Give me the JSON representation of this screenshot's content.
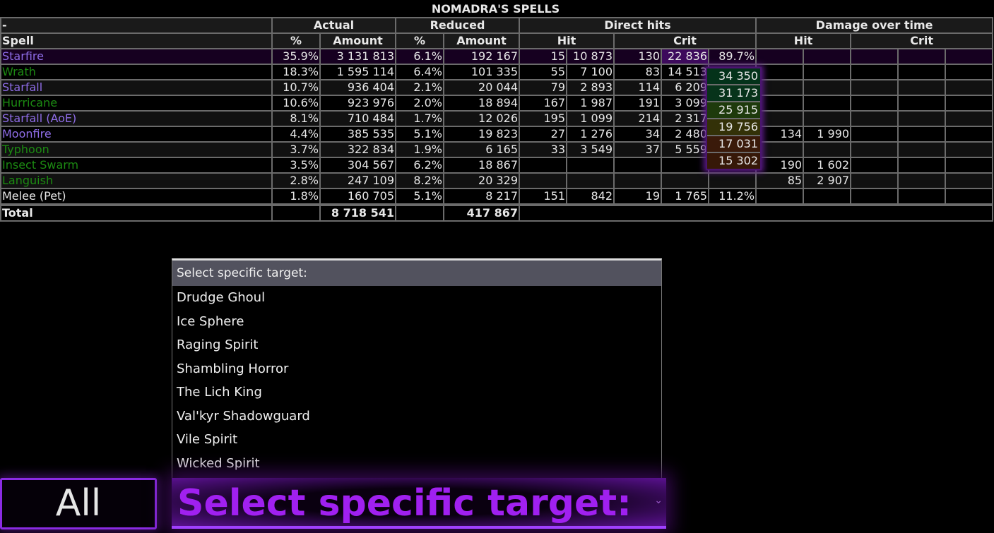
{
  "title": "NOMADRA'S SPELLS",
  "header": {
    "corner": "-",
    "spell": "Spell",
    "groups": [
      "Actual",
      "Reduced",
      "Direct hits",
      "Damage over time"
    ],
    "actual_cols": [
      "%",
      "Amount"
    ],
    "reduced_cols": [
      "%",
      "Amount"
    ],
    "direct_sub": [
      "Hit",
      "Crit"
    ],
    "dot_sub": [
      "Hit",
      "Crit"
    ]
  },
  "rows": [
    {
      "name": "Starfire",
      "color": "purple",
      "actual_pct": "35.9%",
      "actual_amt": "3 131 813",
      "red_pct": "6.1%",
      "red_amt": "192 167",
      "dh_hit_n": "15",
      "dh_hit_avg": "10 873",
      "dh_crit_n": "130",
      "dh_crit_avg": "22 836",
      "dh_crit_pct": "89.7%",
      "dot_hit_n": "",
      "dot_hit_avg": "",
      "dot_c1": "",
      "dot_c2": "",
      "dot_c3": ""
    },
    {
      "name": "Wrath",
      "color": "green",
      "actual_pct": "18.3%",
      "actual_amt": "1 595 114",
      "red_pct": "6.4%",
      "red_amt": "101 335",
      "dh_hit_n": "55",
      "dh_hit_avg": "7 100",
      "dh_crit_n": "83",
      "dh_crit_avg": "14 513",
      "dh_crit_pct": "",
      "dot_hit_n": "",
      "dot_hit_avg": "",
      "dot_c1": "",
      "dot_c2": "",
      "dot_c3": ""
    },
    {
      "name": "Starfall",
      "color": "purple",
      "actual_pct": "10.7%",
      "actual_amt": "936 404",
      "red_pct": "2.1%",
      "red_amt": "20 044",
      "dh_hit_n": "79",
      "dh_hit_avg": "2 893",
      "dh_crit_n": "114",
      "dh_crit_avg": "6 209",
      "dh_crit_pct": "",
      "dot_hit_n": "",
      "dot_hit_avg": "",
      "dot_c1": "",
      "dot_c2": "",
      "dot_c3": ""
    },
    {
      "name": "Hurricane",
      "color": "green",
      "actual_pct": "10.6%",
      "actual_amt": "923 976",
      "red_pct": "2.0%",
      "red_amt": "18 894",
      "dh_hit_n": "167",
      "dh_hit_avg": "1 987",
      "dh_crit_n": "191",
      "dh_crit_avg": "3 099",
      "dh_crit_pct": "",
      "dot_hit_n": "",
      "dot_hit_avg": "",
      "dot_c1": "",
      "dot_c2": "",
      "dot_c3": ""
    },
    {
      "name": "Starfall (AoE)",
      "color": "purple",
      "actual_pct": "8.1%",
      "actual_amt": "710 484",
      "red_pct": "1.7%",
      "red_amt": "12 026",
      "dh_hit_n": "195",
      "dh_hit_avg": "1 099",
      "dh_crit_n": "214",
      "dh_crit_avg": "2 317",
      "dh_crit_pct": "",
      "dot_hit_n": "",
      "dot_hit_avg": "",
      "dot_c1": "",
      "dot_c2": "",
      "dot_c3": ""
    },
    {
      "name": "Moonfire",
      "color": "purple",
      "actual_pct": "4.4%",
      "actual_amt": "385 535",
      "red_pct": "5.1%",
      "red_amt": "19 823",
      "dh_hit_n": "27",
      "dh_hit_avg": "1 276",
      "dh_crit_n": "34",
      "dh_crit_avg": "2 480",
      "dh_crit_pct": "",
      "dot_hit_n": "134",
      "dot_hit_avg": "1 990",
      "dot_c1": "",
      "dot_c2": "",
      "dot_c3": ""
    },
    {
      "name": "Typhoon",
      "color": "green",
      "actual_pct": "3.7%",
      "actual_amt": "322 834",
      "red_pct": "1.9%",
      "red_amt": "6 165",
      "dh_hit_n": "33",
      "dh_hit_avg": "3 549",
      "dh_crit_n": "37",
      "dh_crit_avg": "5 559",
      "dh_crit_pct": "",
      "dot_hit_n": "",
      "dot_hit_avg": "",
      "dot_c1": "",
      "dot_c2": "",
      "dot_c3": ""
    },
    {
      "name": "Insect Swarm",
      "color": "green",
      "actual_pct": "3.5%",
      "actual_amt": "304 567",
      "red_pct": "6.2%",
      "red_amt": "18 867",
      "dh_hit_n": "",
      "dh_hit_avg": "",
      "dh_crit_n": "",
      "dh_crit_avg": "",
      "dh_crit_pct": "",
      "dot_hit_n": "190",
      "dot_hit_avg": "1 602",
      "dot_c1": "",
      "dot_c2": "",
      "dot_c3": ""
    },
    {
      "name": "Languish",
      "color": "green",
      "actual_pct": "2.8%",
      "actual_amt": "247 109",
      "red_pct": "8.2%",
      "red_amt": "20 329",
      "dh_hit_n": "",
      "dh_hit_avg": "",
      "dh_crit_n": "",
      "dh_crit_avg": "",
      "dh_crit_pct": "",
      "dot_hit_n": "85",
      "dot_hit_avg": "2 907",
      "dot_c1": "",
      "dot_c2": "",
      "dot_c3": ""
    },
    {
      "name": "Melee (Pet)",
      "color": "white",
      "actual_pct": "1.8%",
      "actual_amt": "160 705",
      "red_pct": "5.1%",
      "red_amt": "8 217",
      "dh_hit_n": "151",
      "dh_hit_avg": "842",
      "dh_crit_n": "19",
      "dh_crit_avg": "1 765",
      "dh_crit_pct": "11.2%",
      "dot_hit_n": "",
      "dot_hit_avg": "",
      "dot_c1": "",
      "dot_c2": "",
      "dot_c3": ""
    }
  ],
  "total": {
    "label": "Total",
    "actual_amt": "8 718 541",
    "red_amt": "417 867"
  },
  "popup": [
    {
      "value": "34 350",
      "bg": "#04321a"
    },
    {
      "value": "31 173",
      "bg": "#07331a"
    },
    {
      "value": "25 915",
      "bg": "#1e3a0c"
    },
    {
      "value": "19 756",
      "bg": "#333108"
    },
    {
      "value": "17 031",
      "bg": "#3a1a0a"
    },
    {
      "value": "15 302",
      "bg": "#361808"
    }
  ],
  "colors": {
    "purple": "#8f6de8",
    "green": "#1c8a12",
    "white": "#e8e8e8",
    "accent": "#a020f0"
  },
  "dropdown": {
    "header": "Select specific target:",
    "items": [
      "Drudge Ghoul",
      "Ice Sphere",
      "Raging Spirit",
      "Shambling Horror",
      "The Lich King",
      "Val'kyr Shadowguard",
      "Vile Spirit",
      "Wicked Spirit"
    ]
  },
  "controls": {
    "all_label": "All",
    "select_value": "Select specific target:",
    "chevron": "⌄"
  }
}
